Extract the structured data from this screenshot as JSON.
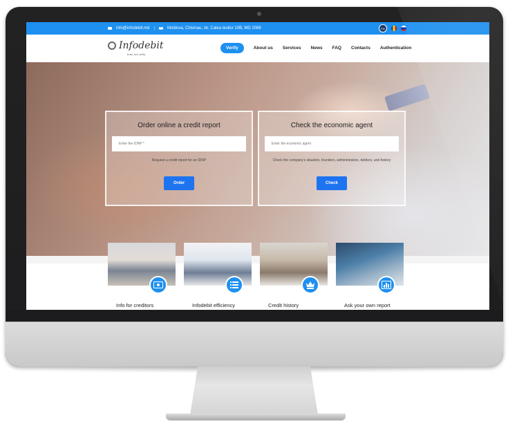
{
  "topbar": {
    "email": "info@infodebit.md",
    "address": "Moldova, Chisinau, str. Calea Iesilor 10B, MD 2069",
    "separator": "|",
    "languages": [
      "EN",
      "RO",
      "RU"
    ]
  },
  "brand": {
    "logo_text": "Infodebit",
    "tagline": "trust, but verify"
  },
  "nav": {
    "items": [
      "Verify",
      "About us",
      "Services",
      "News",
      "FAQ",
      "Contacts",
      "Authentication"
    ],
    "active": "Verify"
  },
  "panels": {
    "credit": {
      "title": "Order online a credit report",
      "placeholder": "Enter the IDNP *",
      "hint": "Request a credit report for an IDNP",
      "button": "Order"
    },
    "agent": {
      "title": "Check the economic agent",
      "placeholder": "Enter the economic agent",
      "hint": "Check the company's situation, founders, administrators, debtors, and history",
      "button": "Check"
    }
  },
  "features": [
    {
      "title": "Info for creditors",
      "icon": "money-icon"
    },
    {
      "title": "Infodebit efficiency",
      "icon": "list-icon"
    },
    {
      "title": "Credit history",
      "icon": "crown-icon"
    },
    {
      "title": "Ask your own report",
      "icon": "chart-icon"
    }
  ],
  "colors": {
    "accent": "#1e90f0",
    "button": "#1e73f0"
  }
}
